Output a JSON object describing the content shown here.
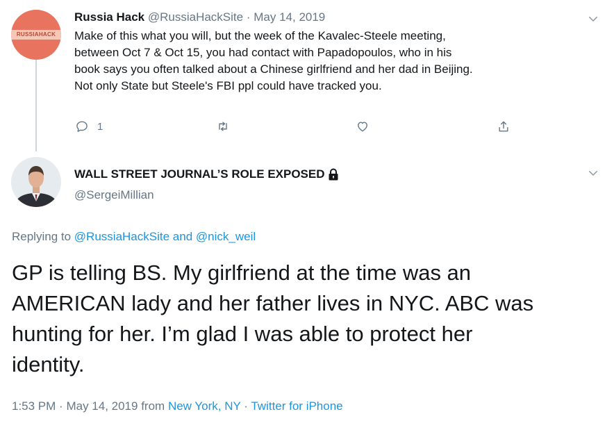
{
  "parent_tweet": {
    "display_name": "Russia Hack",
    "handle": "@RussiaHackSite",
    "separator": "·",
    "date": "May 14, 2019",
    "avatar_logo_text": "RUSSIAHACK",
    "body_lines": [
      "Make of this what you will, but the week of the Kavalec-Steele meeting,",
      "between Oct 7 & Oct 15, you had contact with Papadopoulos, who in his",
      "book says you often talked about a Chinese girlfriend and her dad in Beijing.",
      "Not only State but Steele's FBI ppl could have tracked you."
    ],
    "reply_count": "1",
    "icons": {
      "reply": "reply-icon",
      "retweet": "retweet-icon",
      "like": "heart-icon",
      "share": "share-icon",
      "menu": "chevron-down-icon"
    }
  },
  "main_tweet": {
    "display_name": "WALL STREET JOURNAL’S ROLE EXPOSED",
    "handle": "@SergeiMillian",
    "protected_icon": "lock-icon",
    "replying_prefix": "Replying to",
    "reply_to_1": "@RussiaHackSite",
    "reply_and": "and",
    "reply_to_2": "@nick_weil",
    "body_lines": [
      "GP is telling BS. My girlfriend at the time was an",
      "AMERICAN lady and her father lives in NYC. ABC was",
      "hunting for her. I’m glad I was able to protect her",
      "identity."
    ],
    "time": "1:53 PM",
    "separator": "·",
    "date": "May 14, 2019",
    "from_label": "from",
    "location": "New York, NY",
    "source": "Twitter for iPhone"
  },
  "colors": {
    "text": "#14171a",
    "muted": "#657786",
    "link": "#1b95e0",
    "thread_line": "#ccd6dd",
    "avatar_orange": "#e8735f"
  }
}
